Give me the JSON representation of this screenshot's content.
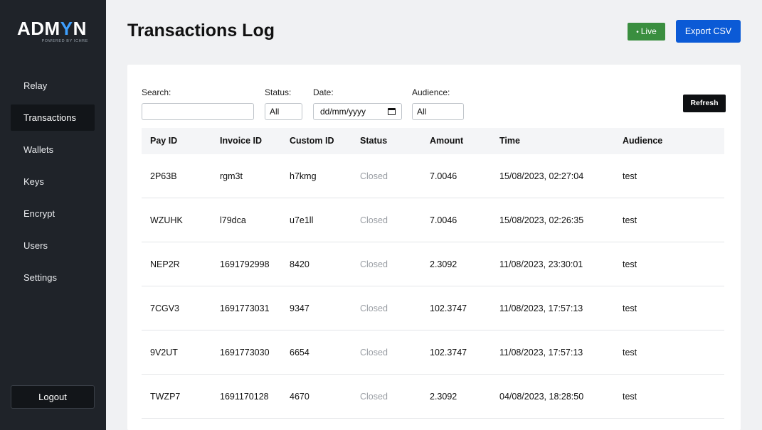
{
  "brand": {
    "name_left": "ADM",
    "name_y": "Y",
    "name_right": "N",
    "tagline": "POWERED BY ICHRE"
  },
  "sidebar": {
    "items": [
      {
        "label": "Relay",
        "active": false
      },
      {
        "label": "Transactions",
        "active": true
      },
      {
        "label": "Wallets",
        "active": false
      },
      {
        "label": "Keys",
        "active": false
      },
      {
        "label": "Encrypt",
        "active": false
      },
      {
        "label": "Users",
        "active": false
      },
      {
        "label": "Settings",
        "active": false
      }
    ],
    "logout_label": "Logout"
  },
  "header": {
    "title": "Transactions Log",
    "live_label": "Live",
    "export_label": "Export CSV"
  },
  "filters": {
    "search_label": "Search:",
    "search_value": "",
    "status_label": "Status:",
    "status_value": "All",
    "date_label": "Date:",
    "date_value": "dd/mm/yyyy",
    "audience_label": "Audience:",
    "audience_value": "All",
    "refresh_label": "Refresh"
  },
  "table": {
    "columns": [
      "Pay ID",
      "Invoice ID",
      "Custom ID",
      "Status",
      "Amount",
      "Time",
      "Audience"
    ],
    "rows": [
      [
        "2P63B",
        "rgm3t",
        "h7kmg",
        "Closed",
        "7.0046",
        "15/08/2023, 02:27:04",
        "test"
      ],
      [
        "WZUHK",
        "l79dca",
        "u7e1ll",
        "Closed",
        "7.0046",
        "15/08/2023, 02:26:35",
        "test"
      ],
      [
        "NEP2R",
        "1691792998",
        "8420",
        "Closed",
        "2.3092",
        "11/08/2023, 23:30:01",
        "test"
      ],
      [
        "7CGV3",
        "1691773031",
        "9347",
        "Closed",
        "102.3747",
        "11/08/2023, 17:57:13",
        "test"
      ],
      [
        "9V2UT",
        "1691773030",
        "6654",
        "Closed",
        "102.3747",
        "11/08/2023, 17:57:13",
        "test"
      ],
      [
        "TWZP7",
        "1691170128",
        "4670",
        "Closed",
        "2.3092",
        "04/08/2023, 18:28:50",
        "test"
      ]
    ]
  },
  "colors": {
    "sidebar_bg": "#1f2329",
    "accent_blue": "#0b5ad6",
    "live_green": "#3a8e3f",
    "status_gray": "#9a9ea4"
  }
}
